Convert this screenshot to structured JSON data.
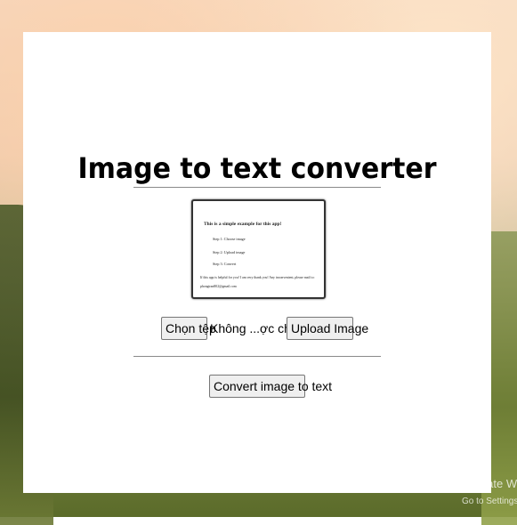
{
  "app": {
    "title": "Image to text converter"
  },
  "preview": {
    "title": "This is a simple example for this app!",
    "steps": [
      "Step 1: Choose image",
      "Step 2: Upload image",
      "Step 3: Convert"
    ],
    "note": "If this app is helpful for you! I am very thank you! Any inconvenient, please mail to: phongtran802@gmail.com"
  },
  "upload": {
    "choose_label": "Chọn tệp",
    "file_status": "Không ...ợc chọn",
    "upload_label": "Upload Image"
  },
  "actions": {
    "convert_label": "Convert image to text"
  },
  "system": {
    "watermark_line1": "Activate Wi",
    "watermark_line2": "Go to Settings"
  }
}
